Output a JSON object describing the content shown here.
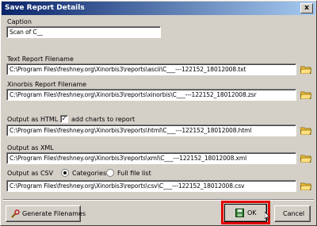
{
  "window": {
    "title": "Save Report Details",
    "close_glyph": "x"
  },
  "caption": {
    "label": "Caption",
    "value": "Scan of C__"
  },
  "text_report": {
    "label": "Text Report Filename",
    "value": "C:\\Program Files\\freshney.org\\Xinorbis3\\reports\\ascii\\C___---122152_18012008.txt"
  },
  "xinorbis_report": {
    "label": "Xinorbis Report Filename",
    "value": "C:\\Program Files\\freshney.org\\Xinorbis3\\reports\\xinorbis\\C___---122152_18012008.zsr"
  },
  "html_output": {
    "label": "Output as HTML",
    "checkbox_label": "add charts to report",
    "checked": true,
    "value": "C:\\Program Files\\freshney.org\\Xinorbis3\\reports\\html\\C___---122152_18012008.html"
  },
  "xml_output": {
    "label": "Output as XML",
    "value": "C:\\Program Files\\freshney.org\\Xinorbis3\\reports\\xml\\C___---122152_18012008.xml"
  },
  "csv_output": {
    "label": "Output as CSV",
    "radio_categories": "Categories",
    "radio_full": "Full file list",
    "selected": "Categories",
    "value": "C:\\Program Files\\freshney.org\\Xinorbis3\\reports\\csv\\C___---122152_18012008.csv"
  },
  "buttons": {
    "generate": "Generate Filenames",
    "ok": "OK",
    "cancel": "Cancel"
  },
  "icons": {
    "folder": "folder-icon",
    "generate": "wrench-icon",
    "ok": "disk-icon"
  },
  "colors": {
    "highlight": "#e10000",
    "folder": "#f0c040"
  }
}
